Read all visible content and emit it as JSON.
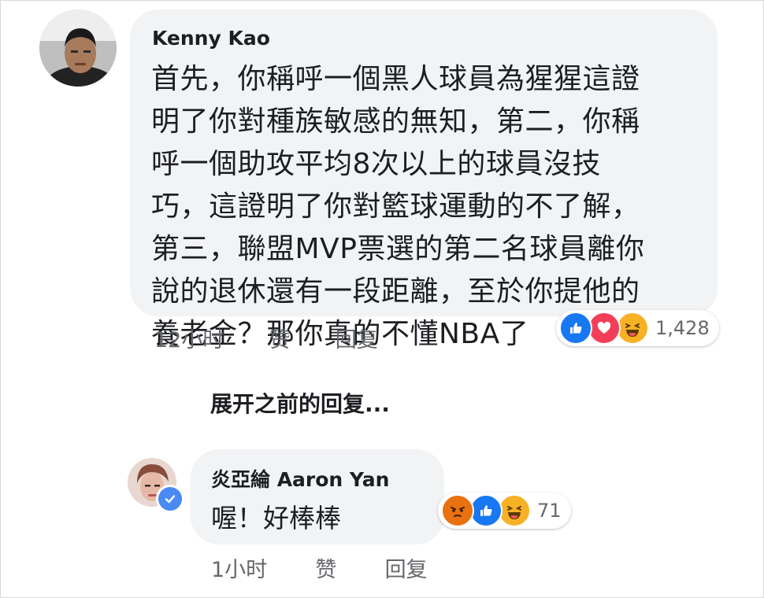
{
  "comments": [
    {
      "author": "Kenny Kao",
      "text": "首先，你稱呼一個黑人球員為猩猩這證\n明了你對種族敏感的無知，第二，你稱\n呼一個助攻平均8次以上的球員沒技\n巧，這證明了你對籃球運動的不了解，\n第三，聯盟MVP票選的第二名球員離你\n說的退休還有一段距離，至於你提他的\n養老金？那你真的不懂NBA了",
      "time": "12小时",
      "like_label": "赞",
      "reply_label": "回复",
      "reactions": {
        "icons": [
          "like-icon",
          "love-icon",
          "haha-icon"
        ],
        "count": "1,428"
      }
    },
    {
      "author": "炎亞綸 Aaron Yan",
      "verified": true,
      "text": "喔！好棒棒",
      "time": "1小时",
      "like_label": "赞",
      "reply_label": "回复",
      "reactions": {
        "icons": [
          "angry-icon",
          "like-icon",
          "haha-icon"
        ],
        "count": "71"
      }
    }
  ],
  "expand_previous_replies": "展开之前的回复...",
  "colors": {
    "bubble": "#f2f3f5",
    "meta_text": "#65676b",
    "like_blue": "#1877f2",
    "love_red": "#f33e58",
    "haha_yellow": "#f7b125",
    "angry_orange": "#e9710f",
    "verified_blue": "#4a8af4"
  }
}
